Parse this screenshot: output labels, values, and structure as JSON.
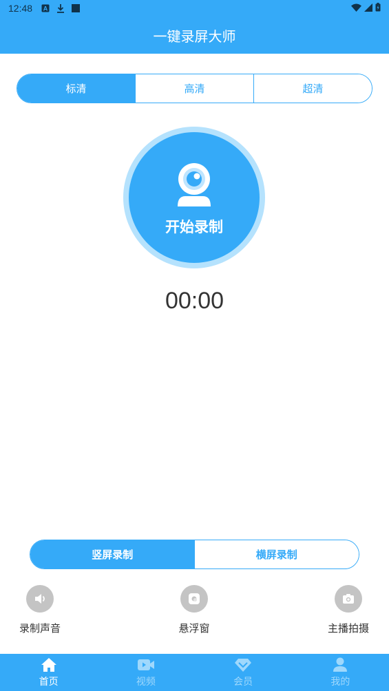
{
  "status_bar": {
    "time": "12:48"
  },
  "app_title": "一键录屏大师",
  "quality": {
    "options": [
      "标清",
      "高清",
      "超清"
    ],
    "selected": "标清"
  },
  "record": {
    "label": "开始录制",
    "icon": "webcam-icon"
  },
  "timer": "00:00",
  "orientation": {
    "options": [
      "竖屏录制",
      "横屏录制"
    ],
    "selected": "竖屏录制"
  },
  "tools": [
    {
      "label": "录制声音",
      "icon": "speaker-icon"
    },
    {
      "label": "悬浮窗",
      "icon": "floating-window-icon"
    },
    {
      "label": "主播拍摄",
      "icon": "camera-icon"
    }
  ],
  "tabs": [
    {
      "label": "首页",
      "icon": "home-icon",
      "active": true
    },
    {
      "label": "视频",
      "icon": "video-icon",
      "active": false
    },
    {
      "label": "会员",
      "icon": "diamond-icon",
      "active": false
    },
    {
      "label": "我的",
      "icon": "person-icon",
      "active": false
    }
  ],
  "colors": {
    "primary": "#35aaf8",
    "ring": "#b5e2fd",
    "tool_bg": "#c4c4c4",
    "tab_inactive": "#9fd8fc"
  }
}
